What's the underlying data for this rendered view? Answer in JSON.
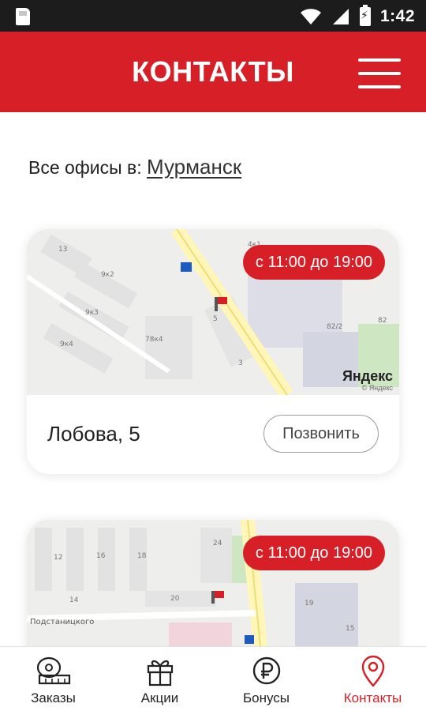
{
  "status_bar": {
    "time": "1:42"
  },
  "header": {
    "title": "КОНТАКТЫ"
  },
  "offices": {
    "prefix": "Все офисы в:",
    "city": "Мурманск"
  },
  "cards": [
    {
      "hours": "с 11:00 до 19:00",
      "address": "Лобова, 5",
      "call_label": "Позвонить",
      "map_credit": "Яндекс",
      "map_credit_sub": "© Яндекс"
    },
    {
      "hours": "с 11:00 до 19:00",
      "street_label": "Подстаницкого"
    }
  ],
  "tabs": [
    {
      "label": "Заказы",
      "icon": "tape-measure-icon"
    },
    {
      "label": "Акции",
      "icon": "gift-icon"
    },
    {
      "label": "Бонусы",
      "icon": "ruble-icon"
    },
    {
      "label": "Контакты",
      "icon": "location-pin-icon",
      "active": true
    }
  ],
  "colors": {
    "brand": "#d71f27",
    "statusbar": "#1c1c1c"
  }
}
